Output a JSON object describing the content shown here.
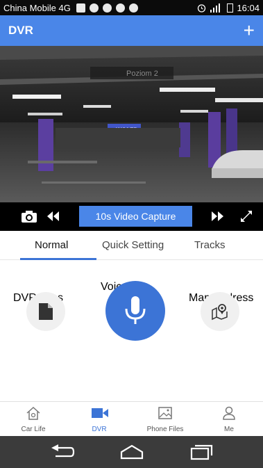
{
  "status_bar": {
    "carrier": "China Mobile 4G",
    "time": "16:04"
  },
  "app_bar": {
    "title": "DVR",
    "add_icon": "plus-icon"
  },
  "video": {
    "overlay_sign_text": "Poziom 2",
    "exit_sign_text": "WJAZD"
  },
  "controls": {
    "capture_label": "10s Video Capture"
  },
  "tabs": [
    {
      "label": "Normal",
      "active": true
    },
    {
      "label": "Quick Setting",
      "active": false
    },
    {
      "label": "Tracks",
      "active": false
    }
  ],
  "features": {
    "dvr_files": "DVR Files",
    "voice": "Voice",
    "map_address": "Map Address"
  },
  "bottom_nav": [
    {
      "label": "Car Life",
      "icon": "home-icon",
      "active": false
    },
    {
      "label": "DVR",
      "icon": "video-camera-icon",
      "active": true
    },
    {
      "label": "Phone Files",
      "icon": "image-icon",
      "active": false
    },
    {
      "label": "Me",
      "icon": "person-icon",
      "active": false
    }
  ],
  "colors": {
    "accent": "#4a86e8",
    "active_tab": "#3c74d6",
    "android_nav": "#3b3b3b"
  }
}
